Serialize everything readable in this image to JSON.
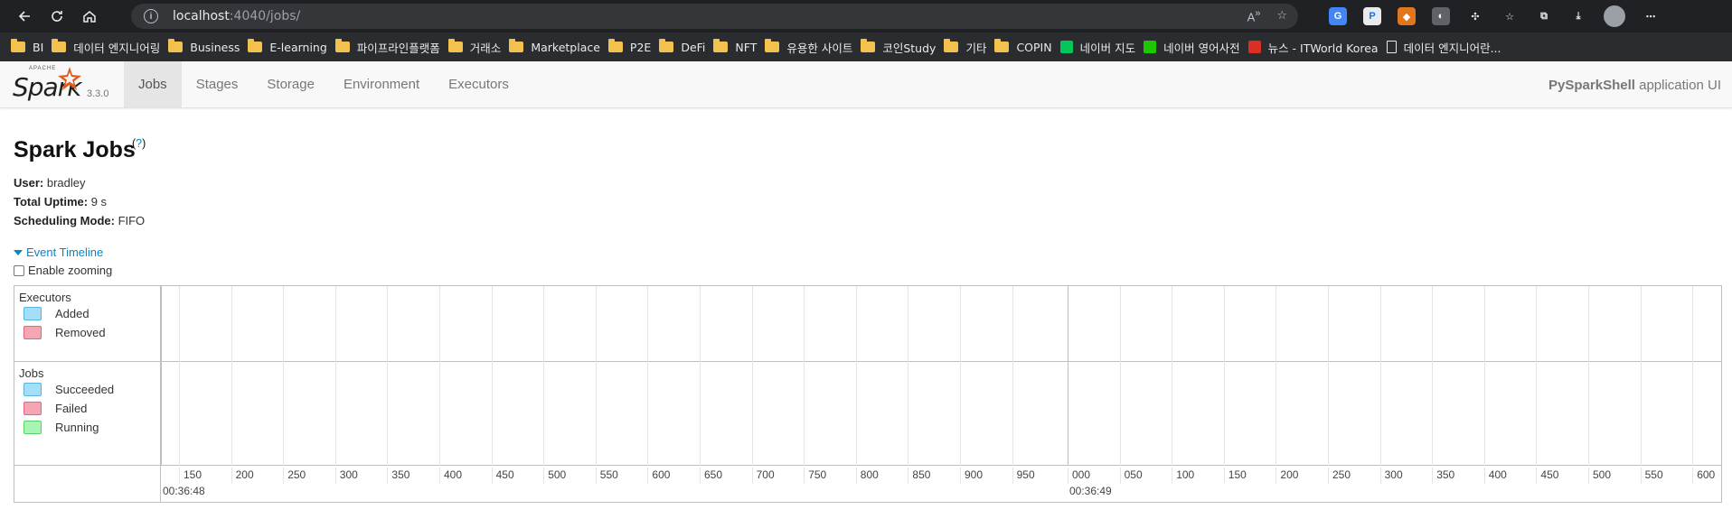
{
  "browser": {
    "url_host": "localhost",
    "url_path": ":4040/jobs/",
    "bookmarks": [
      {
        "label": "BI",
        "type": "folder"
      },
      {
        "label": "데이터 엔지니어링",
        "type": "folder"
      },
      {
        "label": "Business",
        "type": "folder"
      },
      {
        "label": "E-learning",
        "type": "folder"
      },
      {
        "label": "파이프라인플랫폼",
        "type": "folder"
      },
      {
        "label": "거래소",
        "type": "folder"
      },
      {
        "label": "Marketplace",
        "type": "folder"
      },
      {
        "label": "P2E",
        "type": "folder"
      },
      {
        "label": "DeFi",
        "type": "folder"
      },
      {
        "label": "NFT",
        "type": "folder"
      },
      {
        "label": "유용한 사이트",
        "type": "folder"
      },
      {
        "label": "코인Study",
        "type": "folder"
      },
      {
        "label": "기타",
        "type": "folder"
      },
      {
        "label": "COPIN",
        "type": "folder"
      },
      {
        "label": "네이버 지도",
        "type": "site"
      },
      {
        "label": "네이버 영어사전",
        "type": "site"
      },
      {
        "label": "뉴스 - ITWorld Korea",
        "type": "site"
      },
      {
        "label": "데이터 엔지니어란...",
        "type": "page"
      }
    ]
  },
  "spark": {
    "apache_text": "APACHE",
    "logo_text": "Spark",
    "version": "3.3.0",
    "tabs": [
      {
        "label": "Jobs",
        "active": true
      },
      {
        "label": "Stages",
        "active": false
      },
      {
        "label": "Storage",
        "active": false
      },
      {
        "label": "Environment",
        "active": false
      },
      {
        "label": "Executors",
        "active": false
      }
    ],
    "app_name": "PySparkShell",
    "app_suffix": " application UI"
  },
  "page": {
    "title": "Spark Jobs",
    "help": "?",
    "user_label": "User:",
    "user_value": " bradley",
    "uptime_label": "Total Uptime:",
    "uptime_value": " 9 s",
    "sched_label": "Scheduling Mode:",
    "sched_value": " FIFO",
    "timeline_toggle": "Event Timeline",
    "zoom_label": "Enable zooming"
  },
  "timeline": {
    "executors_label": "Executors",
    "executors_legend": [
      {
        "label": "Added",
        "color": "#a5dff7",
        "border": "#59b4e0"
      },
      {
        "label": "Removed",
        "color": "#f6a5b4",
        "border": "#e06682"
      }
    ],
    "jobs_label": "Jobs",
    "jobs_legend": [
      {
        "label": "Succeeded",
        "color": "#a5dff7",
        "border": "#59b4e0"
      },
      {
        "label": "Failed",
        "color": "#f6a5b4",
        "border": "#e06682"
      },
      {
        "label": "Running",
        "color": "#a6f5b2",
        "border": "#5ad06f"
      }
    ],
    "ticks_first": [
      "150",
      "200",
      "250",
      "300",
      "350",
      "400",
      "450",
      "500",
      "550",
      "600",
      "650",
      "700",
      "750",
      "800",
      "850",
      "900",
      "950"
    ],
    "ticks_second": [
      "000",
      "050",
      "100",
      "150",
      "200",
      "250",
      "300",
      "350",
      "400",
      "450",
      "500",
      "550",
      "600"
    ],
    "major_labels": [
      "00:36:48",
      "00:36:49"
    ]
  }
}
